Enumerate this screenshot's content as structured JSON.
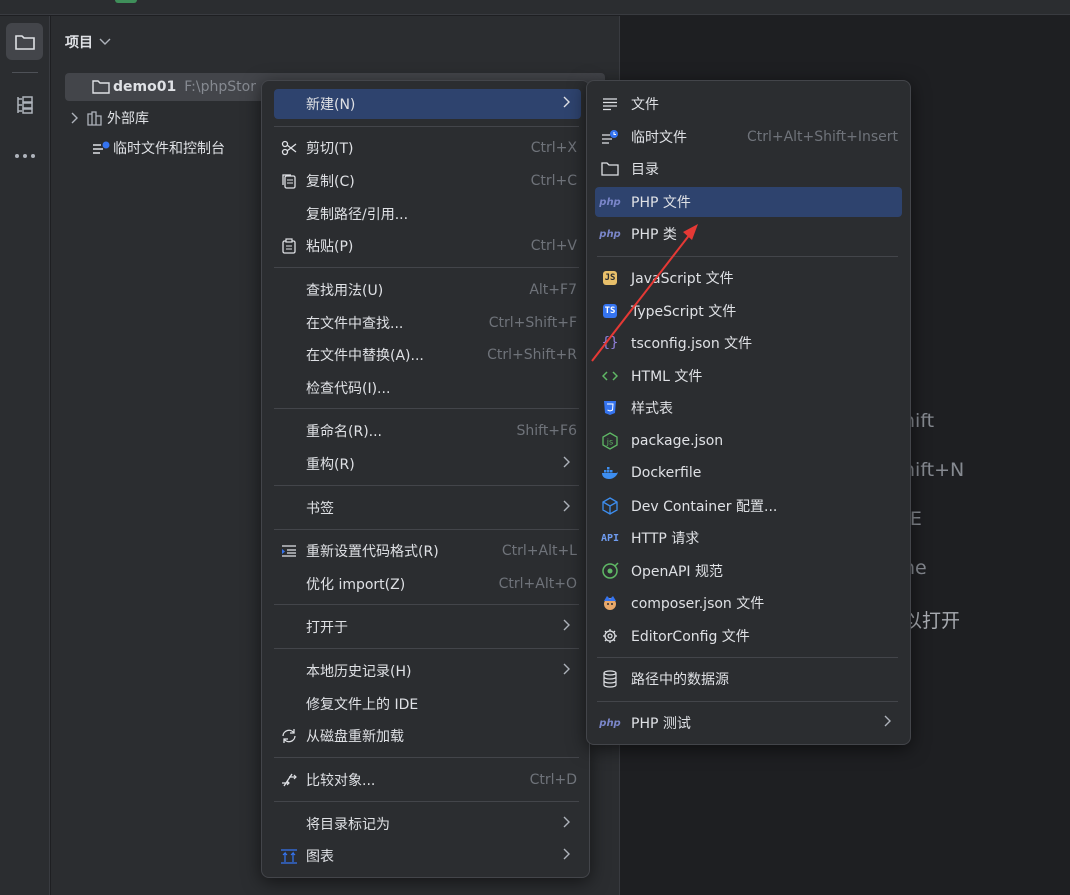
{
  "project_panel": {
    "title": "项目",
    "tree": [
      {
        "label": "demo01",
        "path": "F:\\phpStor"
      },
      {
        "label": "外部库"
      },
      {
        "label": "临时文件和控制台"
      }
    ]
  },
  "editor_hints": [
    "hift",
    "hift+N",
    "-E",
    "ne",
    "以打开"
  ],
  "context_menu": {
    "items": [
      {
        "label": "新建(N)",
        "shortcut": "",
        "submenu": true
      },
      {
        "label": "剪切(T)",
        "shortcut": "Ctrl+X",
        "icon": "scissors-icon"
      },
      {
        "label": "复制(C)",
        "shortcut": "Ctrl+C",
        "icon": "copy-icon"
      },
      {
        "label": "复制路径/引用...",
        "shortcut": ""
      },
      {
        "label": "粘贴(P)",
        "shortcut": "Ctrl+V",
        "icon": "paste-icon"
      },
      {
        "label": "查找用法(U)",
        "shortcut": "Alt+F7"
      },
      {
        "label": "在文件中查找...",
        "shortcut": "Ctrl+Shift+F"
      },
      {
        "label": "在文件中替换(A)...",
        "shortcut": "Ctrl+Shift+R"
      },
      {
        "label": "检查代码(I)...",
        "shortcut": ""
      },
      {
        "label": "重命名(R)...",
        "shortcut": "Shift+F6"
      },
      {
        "label": "重构(R)",
        "shortcut": "",
        "submenu": true
      },
      {
        "label": "书签",
        "shortcut": "",
        "submenu": true
      },
      {
        "label": "重新设置代码格式(R)",
        "shortcut": "Ctrl+Alt+L",
        "icon": "reformat-icon"
      },
      {
        "label": "优化 import(Z)",
        "shortcut": "Ctrl+Alt+O"
      },
      {
        "label": "打开于",
        "shortcut": "",
        "submenu": true
      },
      {
        "label": "本地历史记录(H)",
        "shortcut": "",
        "submenu": true
      },
      {
        "label": "修复文件上的 IDE",
        "shortcut": ""
      },
      {
        "label": "从磁盘重新加载",
        "shortcut": "",
        "icon": "reload-icon"
      },
      {
        "label": "比较对象...",
        "shortcut": "Ctrl+D",
        "icon": "compare-icon"
      },
      {
        "label": "将目录标记为",
        "shortcut": "",
        "submenu": true
      },
      {
        "label": "图表",
        "shortcut": "",
        "submenu": true,
        "icon": "diagram-icon"
      }
    ]
  },
  "new_submenu": {
    "items": [
      {
        "label": "文件",
        "shortcut": "",
        "icon": "file-icon"
      },
      {
        "label": "临时文件",
        "shortcut": "Ctrl+Alt+Shift+Insert",
        "icon": "scratch-file-icon"
      },
      {
        "label": "目录",
        "shortcut": "",
        "icon": "folder-icon"
      },
      {
        "label": "PHP 文件",
        "shortcut": "",
        "icon": "php-icon",
        "highlighted": true
      },
      {
        "label": "PHP 类",
        "shortcut": "",
        "icon": "php-icon"
      },
      {
        "label": "JavaScript 文件",
        "icon": "javascript-icon"
      },
      {
        "label": "TypeScript 文件",
        "icon": "typescript-icon"
      },
      {
        "label": "tsconfig.json 文件",
        "icon": "tsconfig-icon"
      },
      {
        "label": "HTML 文件",
        "icon": "html-icon"
      },
      {
        "label": "样式表",
        "icon": "css-icon"
      },
      {
        "label": "package.json",
        "icon": "nodejs-icon"
      },
      {
        "label": "Dockerfile",
        "icon": "docker-icon"
      },
      {
        "label": "Dev Container 配置...",
        "icon": "dev-container-icon"
      },
      {
        "label": "HTTP 请求",
        "icon": "api-icon"
      },
      {
        "label": "OpenAPI 规范",
        "icon": "openapi-icon"
      },
      {
        "label": "composer.json 文件",
        "icon": "composer-icon"
      },
      {
        "label": "EditorConfig 文件",
        "icon": "editorconfig-icon"
      },
      {
        "label": "路径中的数据源",
        "icon": "database-icon"
      },
      {
        "label": "PHP 测试",
        "submenu": true,
        "icon": "php-test-icon"
      }
    ]
  },
  "colors": {
    "background": "#1e1f22",
    "panel": "#2b2d30",
    "highlight": "#2e436e",
    "arrow": "#e53935"
  }
}
